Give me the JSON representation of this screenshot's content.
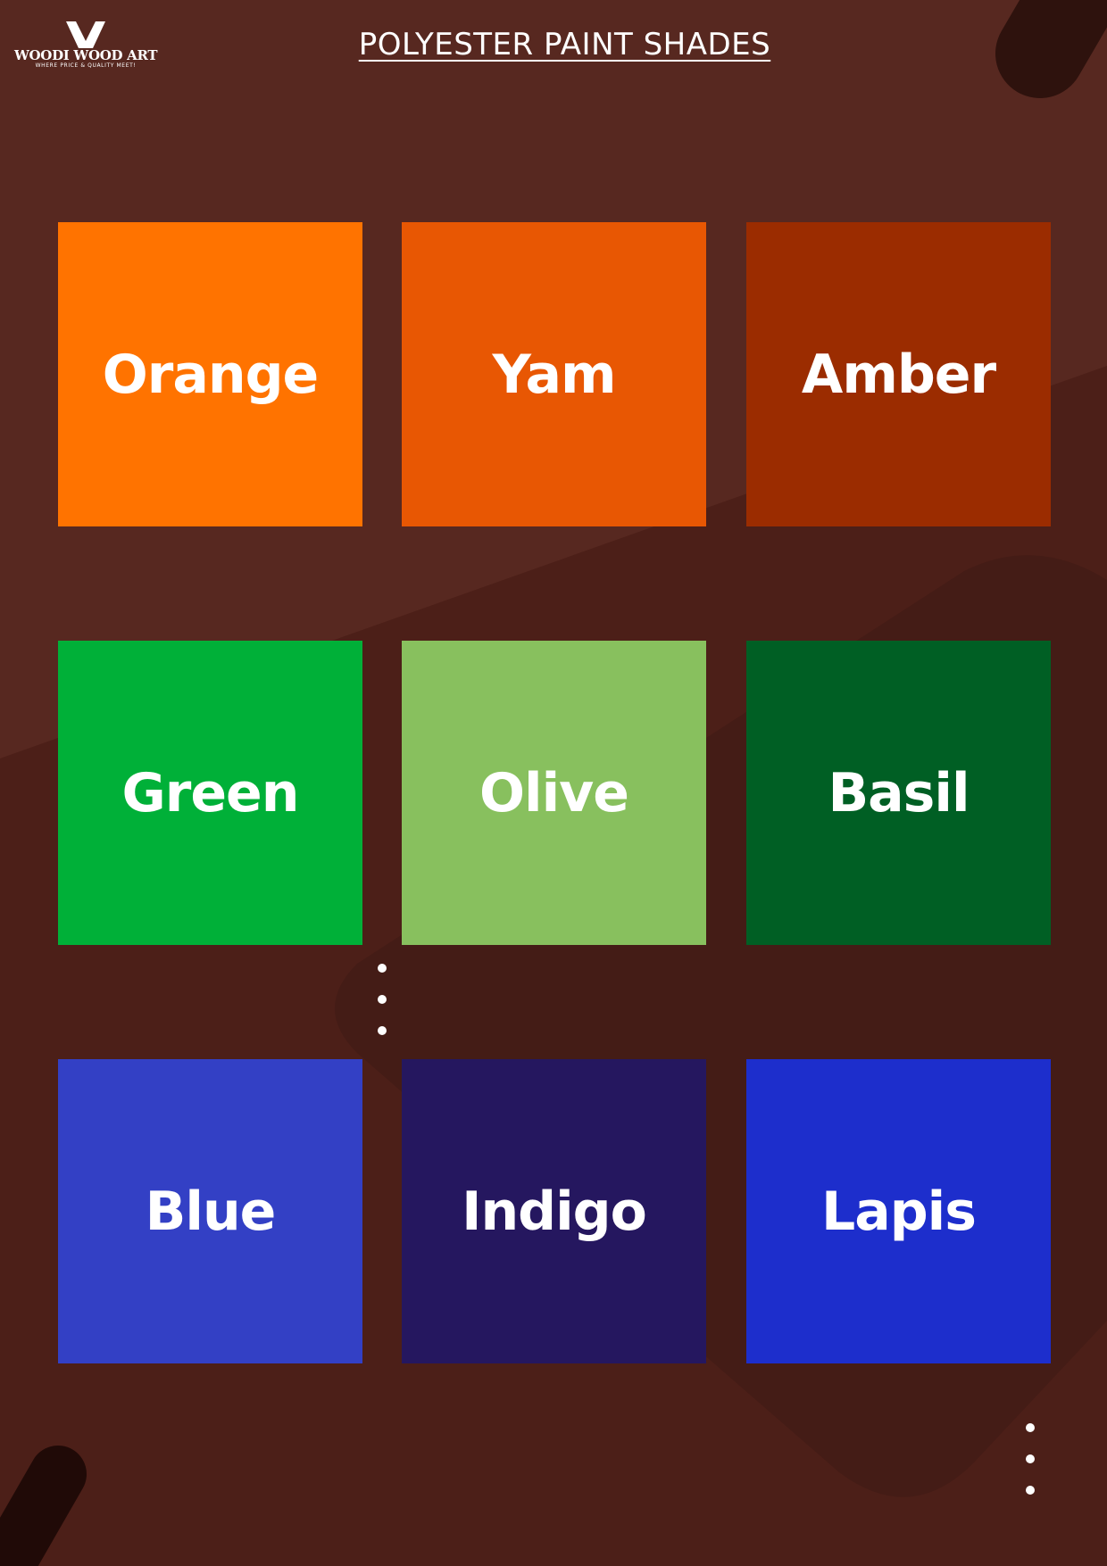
{
  "brand": {
    "name": "WOODI WOOD ART",
    "tagline": "WHERE PRICE & QUALITY MEET!",
    "mark": "W"
  },
  "title": "POLYESTER PAINT SHADES",
  "colors": {
    "background": "#572820",
    "background_dark": "#441c16",
    "accent_dark": "#2e120d",
    "text": "#ffffff"
  },
  "swatches": [
    {
      "label": "Orange",
      "color": "#ff7300"
    },
    {
      "label": "Yam",
      "color": "#e85703"
    },
    {
      "label": "Amber",
      "color": "#9b2c00"
    },
    {
      "label": "Green",
      "color": "#00b038"
    },
    {
      "label": "Olive",
      "color": "#88c05e"
    },
    {
      "label": "Basil",
      "color": "#005f24"
    },
    {
      "label": "Blue",
      "color": "#3340c5"
    },
    {
      "label": "Indigo",
      "color": "#25175f"
    },
    {
      "label": "Lapis",
      "color": "#1d2ecc"
    }
  ]
}
